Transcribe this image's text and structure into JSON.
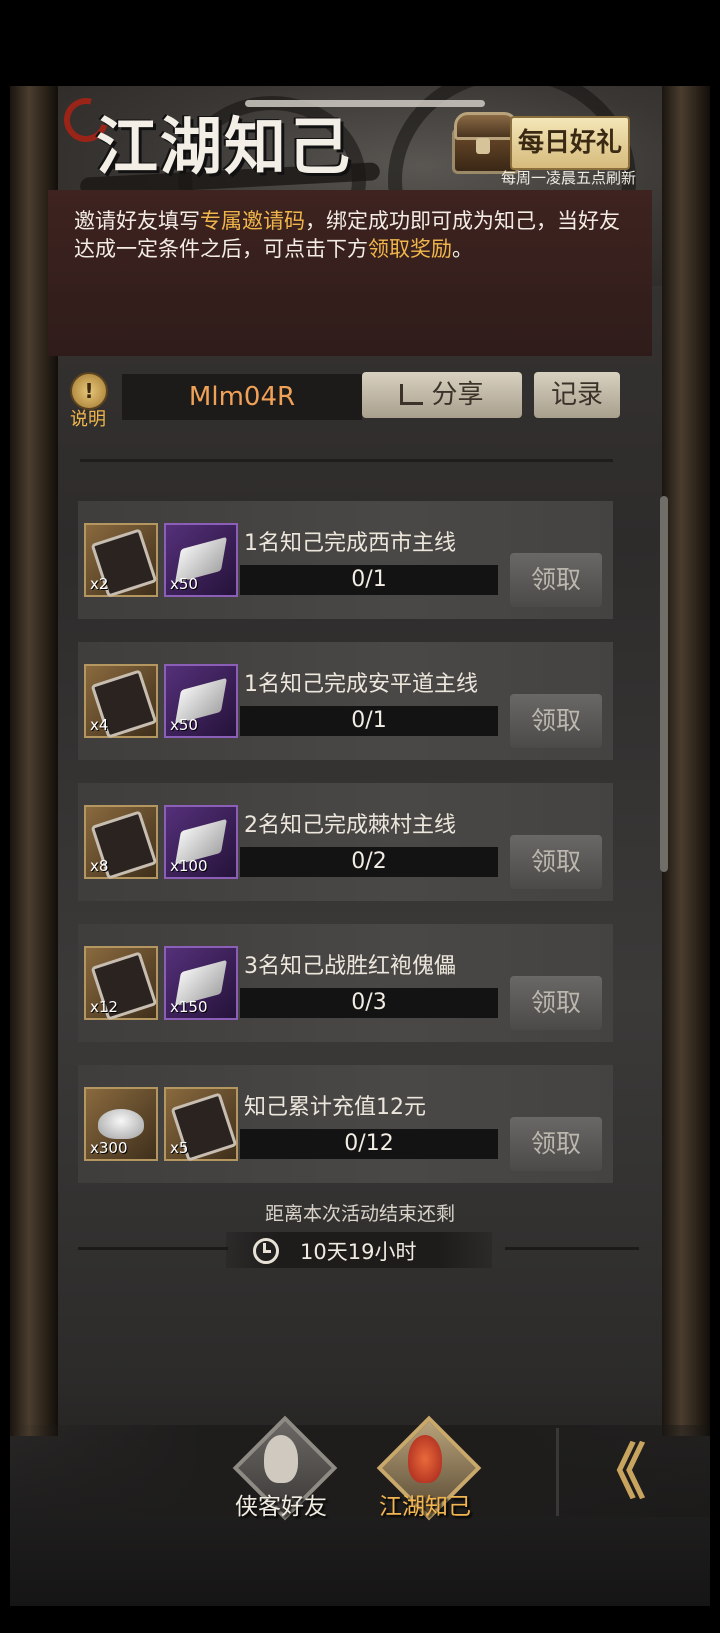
{
  "header": {
    "title": "江湖知己",
    "daily_gift_label": "每日好礼",
    "refresh_note": "每周一凌晨五点刷新"
  },
  "intro": {
    "part1": "邀请好友填写",
    "highlight1": "专属邀请码",
    "part2": "，绑定成功即可成为知己，当好友达成一定条件之后，可点击下方",
    "highlight2": "领取奖励",
    "part3": "。"
  },
  "invite": {
    "help_icon": "!",
    "help_label": "说明",
    "code": "Mlm04R",
    "share_label": "分享",
    "record_label": "记录"
  },
  "tasks": [
    {
      "title": "1名知己完成西市主线",
      "progress_text": "0/1",
      "progress": 0,
      "claim_label": "领取",
      "rewards": [
        {
          "icon": "token-icon",
          "qty": "x2"
        },
        {
          "icon": "silver-bar-icon",
          "qty": "x50"
        }
      ]
    },
    {
      "title": "1名知己完成安平道主线",
      "progress_text": "0/1",
      "progress": 0,
      "claim_label": "领取",
      "rewards": [
        {
          "icon": "token-icon",
          "qty": "x4"
        },
        {
          "icon": "silver-bar-icon",
          "qty": "x50"
        }
      ]
    },
    {
      "title": "2名知己完成棘村主线",
      "progress_text": "0/2",
      "progress": 0,
      "claim_label": "领取",
      "rewards": [
        {
          "icon": "token-icon",
          "qty": "x8"
        },
        {
          "icon": "silver-bar-icon",
          "qty": "x100"
        }
      ]
    },
    {
      "title": "3名知己战胜红袍傀儡",
      "progress_text": "0/3",
      "progress": 0,
      "claim_label": "领取",
      "rewards": [
        {
          "icon": "token-icon",
          "qty": "x12"
        },
        {
          "icon": "silver-bar-icon",
          "qty": "x150"
        }
      ]
    },
    {
      "title": "知己累计充值12元",
      "progress_text": "0/12",
      "progress": 0,
      "claim_label": "领取",
      "rewards": [
        {
          "icon": "silver-ingot-icon",
          "qty": "x300"
        },
        {
          "icon": "token-icon",
          "qty": "x5"
        }
      ]
    }
  ],
  "countdown": {
    "label": "距离本次活动结束还剩",
    "value": "10天19小时"
  },
  "nav": {
    "tabs": [
      {
        "label": "侠客好友",
        "active": false
      },
      {
        "label": "江湖知己",
        "active": true
      }
    ],
    "collapse_glyph": "《"
  }
}
